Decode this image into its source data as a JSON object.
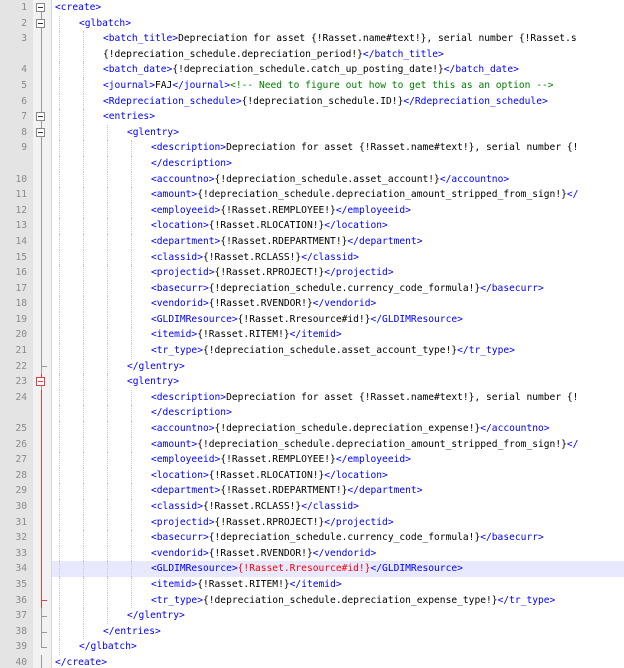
{
  "editor": {
    "lines": [
      {
        "num": "1",
        "indent": 0,
        "segs": [
          {
            "t": "tag",
            "x": "<create>"
          }
        ]
      },
      {
        "num": "2",
        "indent": 1,
        "segs": [
          {
            "t": "tag",
            "x": "<glbatch>"
          }
        ]
      },
      {
        "num": "3",
        "indent": 2,
        "segs": [
          {
            "t": "tag",
            "x": "<batch_title>"
          },
          {
            "t": "txt",
            "x": "Depreciation for asset {!Rasset.name#text!}, serial number {!Rasset.s"
          }
        ]
      },
      {
        "num": "",
        "indent": 2,
        "segs": [
          {
            "t": "txt",
            "x": "{!depreciation_schedule.depreciation_period!}"
          },
          {
            "t": "tag",
            "x": "</batch_title>"
          }
        ]
      },
      {
        "num": "4",
        "indent": 2,
        "segs": [
          {
            "t": "tag",
            "x": "<batch_date>"
          },
          {
            "t": "txt",
            "x": "{!depreciation_schedule.catch_up_posting_date!}"
          },
          {
            "t": "tag",
            "x": "</batch_date>"
          }
        ]
      },
      {
        "num": "5",
        "indent": 2,
        "segs": [
          {
            "t": "tag",
            "x": "<journal>"
          },
          {
            "t": "txt",
            "x": "FAJ"
          },
          {
            "t": "tag",
            "x": "</journal>"
          },
          {
            "t": "cm",
            "x": "<!-- Need to figure out how to get this as an option -->"
          }
        ]
      },
      {
        "num": "6",
        "indent": 2,
        "segs": [
          {
            "t": "tag",
            "x": "<Rdepreciation_schedule>"
          },
          {
            "t": "txt",
            "x": "{!depreciation_schedule.ID!}"
          },
          {
            "t": "tag",
            "x": "</Rdepreciation_schedule>"
          }
        ]
      },
      {
        "num": "7",
        "indent": 2,
        "segs": [
          {
            "t": "tag",
            "x": "<entries>"
          }
        ]
      },
      {
        "num": "8",
        "indent": 3,
        "segs": [
          {
            "t": "tag",
            "x": "<glentry>"
          }
        ]
      },
      {
        "num": "9",
        "indent": 4,
        "segs": [
          {
            "t": "tag",
            "x": "<description>"
          },
          {
            "t": "txt",
            "x": "Depreciation for asset {!Rasset.name#text!}, serial number {!"
          }
        ]
      },
      {
        "num": "",
        "indent": 4,
        "segs": [
          {
            "t": "tag",
            "x": "</description>"
          }
        ]
      },
      {
        "num": "10",
        "indent": 4,
        "segs": [
          {
            "t": "tag",
            "x": "<accountno>"
          },
          {
            "t": "txt",
            "x": "{!depreciation_schedule.asset_account!}"
          },
          {
            "t": "tag",
            "x": "</accountno>"
          }
        ]
      },
      {
        "num": "11",
        "indent": 4,
        "segs": [
          {
            "t": "tag",
            "x": "<amount>"
          },
          {
            "t": "txt",
            "x": "{!depreciation_schedule.depreciation_amount_stripped_from_sign!}"
          },
          {
            "t": "tag",
            "x": "</"
          }
        ]
      },
      {
        "num": "12",
        "indent": 4,
        "segs": [
          {
            "t": "tag",
            "x": "<employeeid>"
          },
          {
            "t": "txt",
            "x": "{!Rasset.REMPLOYEE!}"
          },
          {
            "t": "tag",
            "x": "</employeeid>"
          }
        ]
      },
      {
        "num": "13",
        "indent": 4,
        "segs": [
          {
            "t": "tag",
            "x": "<location>"
          },
          {
            "t": "txt",
            "x": "{!Rasset.RLOCATION!}"
          },
          {
            "t": "tag",
            "x": "</location>"
          }
        ]
      },
      {
        "num": "14",
        "indent": 4,
        "segs": [
          {
            "t": "tag",
            "x": "<department>"
          },
          {
            "t": "txt",
            "x": "{!Rasset.RDEPARTMENT!}"
          },
          {
            "t": "tag",
            "x": "</department>"
          }
        ]
      },
      {
        "num": "15",
        "indent": 4,
        "segs": [
          {
            "t": "tag",
            "x": "<classid>"
          },
          {
            "t": "txt",
            "x": "{!Rasset.RCLASS!}"
          },
          {
            "t": "tag",
            "x": "</classid>"
          }
        ]
      },
      {
        "num": "16",
        "indent": 4,
        "segs": [
          {
            "t": "tag",
            "x": "<projectid>"
          },
          {
            "t": "txt",
            "x": "{!Rasset.RPROJECT!}"
          },
          {
            "t": "tag",
            "x": "</projectid>"
          }
        ]
      },
      {
        "num": "17",
        "indent": 4,
        "segs": [
          {
            "t": "tag",
            "x": "<basecurr>"
          },
          {
            "t": "txt",
            "x": "{!depreciation_schedule.currency_code_formula!}"
          },
          {
            "t": "tag",
            "x": "</basecurr>"
          }
        ]
      },
      {
        "num": "18",
        "indent": 4,
        "segs": [
          {
            "t": "tag",
            "x": "<vendorid>"
          },
          {
            "t": "txt",
            "x": "{!Rasset.RVENDOR!}"
          },
          {
            "t": "tag",
            "x": "</vendorid>"
          }
        ]
      },
      {
        "num": "19",
        "indent": 4,
        "segs": [
          {
            "t": "tag",
            "x": "<GLDIMResource>"
          },
          {
            "t": "txt",
            "x": "{!Rasset.Rresource#id!}"
          },
          {
            "t": "tag",
            "x": "</GLDIMResource>"
          }
        ]
      },
      {
        "num": "20",
        "indent": 4,
        "segs": [
          {
            "t": "tag",
            "x": "<itemid>"
          },
          {
            "t": "txt",
            "x": "{!Rasset.RITEM!}"
          },
          {
            "t": "tag",
            "x": "</itemid>"
          }
        ]
      },
      {
        "num": "21",
        "indent": 4,
        "segs": [
          {
            "t": "tag",
            "x": "<tr_type>"
          },
          {
            "t": "txt",
            "x": "{!depreciation_schedule.asset_account_type!}"
          },
          {
            "t": "tag",
            "x": "</tr_type>"
          }
        ]
      },
      {
        "num": "22",
        "indent": 3,
        "segs": [
          {
            "t": "tag",
            "x": "</glentry>"
          }
        ]
      },
      {
        "num": "23",
        "indent": 3,
        "segs": [
          {
            "t": "tag",
            "x": "<glentry>"
          }
        ]
      },
      {
        "num": "24",
        "indent": 4,
        "segs": [
          {
            "t": "tag",
            "x": "<description>"
          },
          {
            "t": "txt",
            "x": "Depreciation for asset {!Rasset.name#text!}, serial number {!"
          }
        ]
      },
      {
        "num": "",
        "indent": 4,
        "segs": [
          {
            "t": "tag",
            "x": "</description>"
          }
        ]
      },
      {
        "num": "25",
        "indent": 4,
        "segs": [
          {
            "t": "tag",
            "x": "<accountno>"
          },
          {
            "t": "txt",
            "x": "{!depreciation_schedule.depreciation_expense!}"
          },
          {
            "t": "tag",
            "x": "</accountno>"
          }
        ]
      },
      {
        "num": "26",
        "indent": 4,
        "segs": [
          {
            "t": "tag",
            "x": "<amount>"
          },
          {
            "t": "txt",
            "x": "{!depreciation_schedule.depreciation_amount_stripped_from_sign!}"
          },
          {
            "t": "tag",
            "x": "</"
          }
        ]
      },
      {
        "num": "27",
        "indent": 4,
        "segs": [
          {
            "t": "tag",
            "x": "<employeeid>"
          },
          {
            "t": "txt",
            "x": "{!Rasset.REMPLOYEE!}"
          },
          {
            "t": "tag",
            "x": "</employeeid>"
          }
        ]
      },
      {
        "num": "28",
        "indent": 4,
        "segs": [
          {
            "t": "tag",
            "x": "<location>"
          },
          {
            "t": "txt",
            "x": "{!Rasset.RLOCATION!}"
          },
          {
            "t": "tag",
            "x": "</location>"
          }
        ]
      },
      {
        "num": "29",
        "indent": 4,
        "segs": [
          {
            "t": "tag",
            "x": "<department>"
          },
          {
            "t": "txt",
            "x": "{!Rasset.RDEPARTMENT!}"
          },
          {
            "t": "tag",
            "x": "</department>"
          }
        ]
      },
      {
        "num": "30",
        "indent": 4,
        "segs": [
          {
            "t": "tag",
            "x": "<classid>"
          },
          {
            "t": "txt",
            "x": "{!Rasset.RCLASS!}"
          },
          {
            "t": "tag",
            "x": "</classid>"
          }
        ]
      },
      {
        "num": "31",
        "indent": 4,
        "segs": [
          {
            "t": "tag",
            "x": "<projectid>"
          },
          {
            "t": "txt",
            "x": "{!Rasset.RPROJECT!}"
          },
          {
            "t": "tag",
            "x": "</projectid>"
          }
        ]
      },
      {
        "num": "32",
        "indent": 4,
        "segs": [
          {
            "t": "tag",
            "x": "<basecurr>"
          },
          {
            "t": "txt",
            "x": "{!depreciation_schedule.currency_code_formula!}"
          },
          {
            "t": "tag",
            "x": "</basecurr>"
          }
        ]
      },
      {
        "num": "33",
        "indent": 4,
        "segs": [
          {
            "t": "tag",
            "x": "<vendorid>"
          },
          {
            "t": "txt",
            "x": "{!Rasset.RVENDOR!}"
          },
          {
            "t": "tag",
            "x": "</vendorid>"
          }
        ]
      },
      {
        "num": "34",
        "indent": 4,
        "segs": [
          {
            "t": "tag",
            "x": "<GLDIMResource>"
          },
          {
            "t": "hl",
            "x": "{!Rasset.Rresource#id!}"
          },
          {
            "t": "tag",
            "x": "</GLDIMResource>"
          }
        ]
      },
      {
        "num": "35",
        "indent": 4,
        "segs": [
          {
            "t": "tag",
            "x": "<itemid>"
          },
          {
            "t": "txt",
            "x": "{!Rasset.RITEM!}"
          },
          {
            "t": "tag",
            "x": "</itemid>"
          }
        ]
      },
      {
        "num": "36",
        "indent": 4,
        "segs": [
          {
            "t": "tag",
            "x": "<tr_type>"
          },
          {
            "t": "txt",
            "x": "{!depreciation_schedule.depreciation_expense_type!}"
          },
          {
            "t": "tag",
            "x": "</tr_type>"
          }
        ]
      },
      {
        "num": "37",
        "indent": 3,
        "segs": [
          {
            "t": "tag",
            "x": "</glentry>"
          }
        ]
      },
      {
        "num": "38",
        "indent": 2,
        "segs": [
          {
            "t": "tag",
            "x": "</entries>"
          }
        ]
      },
      {
        "num": "39",
        "indent": 1,
        "segs": [
          {
            "t": "tag",
            "x": "</glbatch>"
          }
        ]
      },
      {
        "num": "40",
        "indent": 0,
        "segs": [
          {
            "t": "tag",
            "x": "</create>"
          }
        ]
      }
    ],
    "fold_markers": [
      "box",
      "box",
      "vline",
      "vline",
      "vline",
      "vline",
      "vline",
      "box",
      "box",
      "vline",
      "vline",
      "vline",
      "vline",
      "vline",
      "vline",
      "vline",
      "vline",
      "vline",
      "vline",
      "vline",
      "vline",
      "vline",
      "vline",
      "tick",
      "box-red",
      "vline-red",
      "vline-red",
      "vline-red",
      "vline-red",
      "vline-red",
      "vline-red",
      "vline-red",
      "vline-red",
      "vline-red",
      "vline-red",
      "vline-red",
      "vline-red",
      "vline-red",
      "tick-red",
      "tick",
      "tick",
      "end"
    ],
    "highlighted_line_index": 36,
    "colors": {
      "tag": "#0000ff",
      "comment": "#008000",
      "highlight_text": "#ff0000",
      "current_line_bg": "#e8e8ff",
      "fold_red": "#e04040"
    }
  }
}
